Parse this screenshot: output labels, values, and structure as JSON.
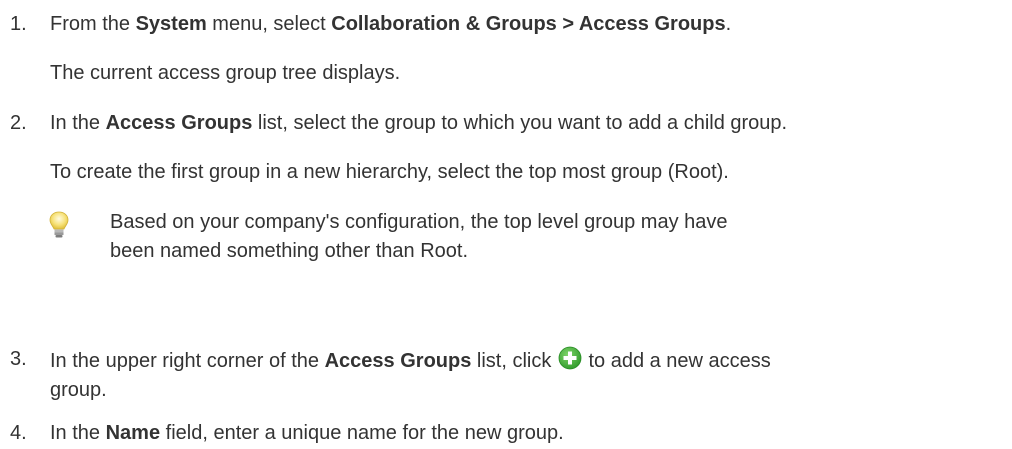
{
  "steps": [
    {
      "number": "1.",
      "parts": [
        "From the ",
        "System",
        " menu, select ",
        "Collaboration & Groups > Access Groups",
        "."
      ],
      "note": "The current access group tree displays."
    },
    {
      "number": "2.",
      "parts": [
        "In the ",
        "Access Groups",
        " list, select the group to which you want to add a child group."
      ],
      "note": "To create the first group in a new hierarchy, select the top most group (Root).",
      "tip": {
        "icon": "lightbulb-icon",
        "line1": "Based on your company's configuration, the top level group may have",
        "line2": "been named something other than Root."
      }
    },
    {
      "number": "3.",
      "parts": [
        "In the upper right corner of the ",
        "Access Groups",
        " list, click ",
        " to add a new access"
      ],
      "line2": "group.",
      "icon": "add-icon",
      "icon_color": "#3aaa35"
    },
    {
      "number": "4.",
      "parts": [
        "In the ",
        "Name",
        " field, enter a unique name for the new group."
      ]
    }
  ]
}
